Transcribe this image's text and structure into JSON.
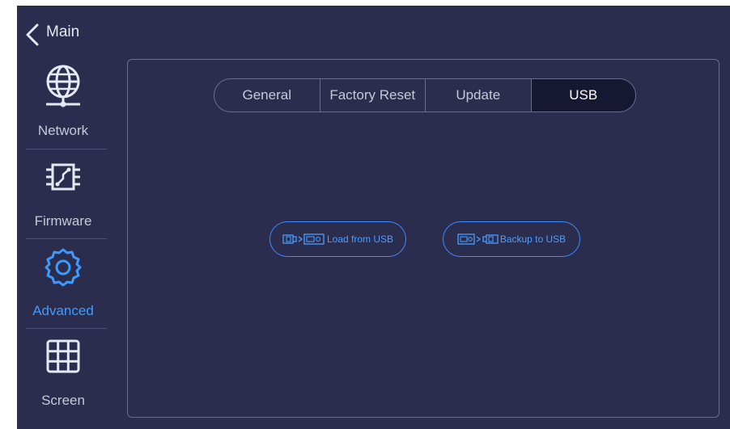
{
  "header": {
    "back_label": "Main"
  },
  "sidebar": {
    "items": [
      {
        "label": "Network",
        "icon": "globe-network-icon"
      },
      {
        "label": "Firmware",
        "icon": "chip-icon"
      },
      {
        "label": "Advanced",
        "icon": "gear-icon",
        "active": true
      },
      {
        "label": "Screen",
        "icon": "grid-icon"
      }
    ]
  },
  "tabs": [
    {
      "label": "General"
    },
    {
      "label": "Factory Reset"
    },
    {
      "label": "Update"
    },
    {
      "label": "USB",
      "active": true
    }
  ],
  "actions": {
    "load_label": "Load from USB",
    "backup_label": "Backup to USB"
  },
  "colors": {
    "background": "#2b2d4f",
    "accent": "#3d9bff",
    "active_tab": "#161832",
    "border": "#6a6d8e"
  }
}
